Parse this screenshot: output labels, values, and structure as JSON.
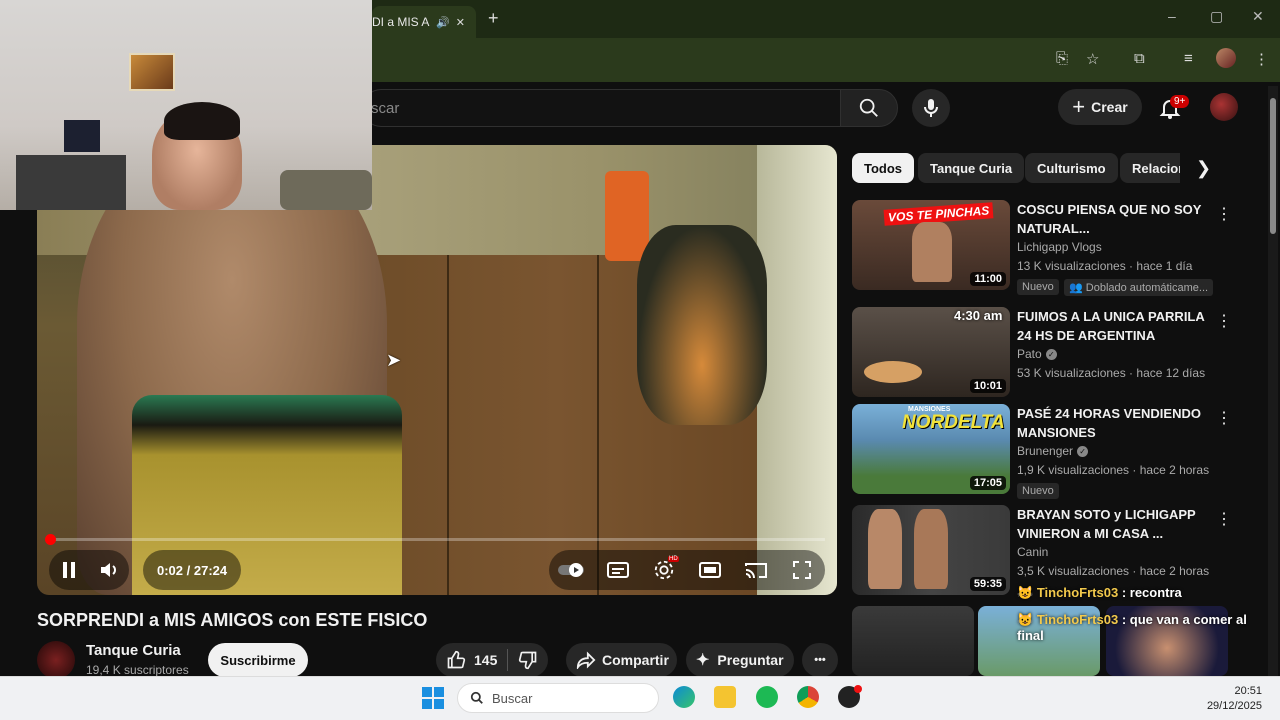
{
  "browser": {
    "tab_title": "DI a MIS AMIG",
    "new_tab": "+",
    "win_min": "–",
    "win_max": "▢",
    "win_close": "✕"
  },
  "header": {
    "search_placeholder": "scar",
    "create_label": "Crear",
    "notifications_badge": "9+"
  },
  "player": {
    "time": "0:02 / 27:24",
    "progress": 0.0012
  },
  "video": {
    "title": "SORPRENDI a MIS AMIGOS con ESTE FISICO",
    "channel": "Tanque Curia",
    "subscribers": "19,4 K suscriptores",
    "subscribe_label": "Suscribirme",
    "likes": "145",
    "share_label": "Compartir",
    "ask_label": "Preguntar",
    "more": "•••"
  },
  "chips": [
    "Todos",
    "Tanque Curia",
    "Culturismo",
    "Relacion"
  ],
  "related": [
    {
      "title": "COSCU PIENSA QUE NO SOY NATURAL...",
      "channel": "Lichigapp Vlogs",
      "meta": "13 K visualizaciones · hace 1 día",
      "duration": "11:00",
      "badge": "Nuevo",
      "badge2": "Doblado automáticame...",
      "thumb_text": "VOS TE PINCHAS"
    },
    {
      "title": "FUIMOS A LA UNICA PARRILA 24 HS DE ARGENTINA",
      "channel": "Pato",
      "meta": "53 K visualizaciones · hace 12 días",
      "duration": "10:01",
      "thumb_text": "4:30 am"
    },
    {
      "title": "PASÉ 24 HORAS VENDIENDO MANSIONES",
      "channel": "Brunenger",
      "meta": "1,9 K visualizaciones · hace 2 horas",
      "duration": "17:05",
      "badge": "Nuevo",
      "thumb_text": "NORDELTA",
      "thumb_small": "MANSIONES"
    },
    {
      "title": "BRAYAN SOTO y LICHIGAPP VINIERON a MI CASA ...",
      "channel": "Canin",
      "meta": "3,5 K visualizaciones · hace 2 horas",
      "duration": "59:35"
    }
  ],
  "chat": [
    {
      "user": "TinchoFrts03",
      "text": " : recontra"
    },
    {
      "user": "TinchoFrts03",
      "text": " : que van a comer al final"
    }
  ],
  "taskbar": {
    "search_label": "Buscar",
    "time": "20:51",
    "date": "29/12/2025"
  },
  "colors": {
    "accent_red": "#ff0000",
    "bg": "#0f0f0f",
    "chat_user": "#f2c94c"
  }
}
